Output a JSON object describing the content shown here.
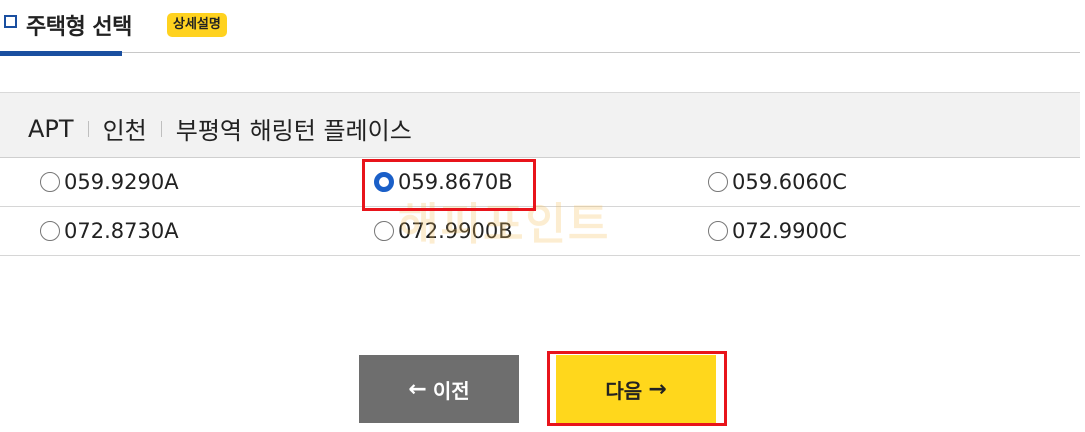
{
  "section": {
    "title": "주택형 선택",
    "detail_badge": "상세설명"
  },
  "breadcrumb": {
    "items": [
      "APT",
      "인천",
      "부평역 해링턴 플레이스"
    ]
  },
  "options": {
    "rows": [
      [
        {
          "label": "059.9290A",
          "selected": false
        },
        {
          "label": "059.8670B",
          "selected": true
        },
        {
          "label": "059.6060C",
          "selected": false
        }
      ],
      [
        {
          "label": "072.8730A",
          "selected": false
        },
        {
          "label": "072.9900B",
          "selected": false
        },
        {
          "label": "072.9900C",
          "selected": false
        }
      ]
    ]
  },
  "watermark": "해피포인트",
  "buttons": {
    "prev_label": "이전",
    "prev_arrow": "←",
    "next_label": "다음",
    "next_arrow": "→"
  },
  "colors": {
    "accent_blue": "#1a4fa0",
    "badge_yellow": "#ffd21f",
    "next_yellow": "#ffd71c",
    "prev_gray": "#6e6e6e",
    "highlight_red": "#e8141b"
  }
}
